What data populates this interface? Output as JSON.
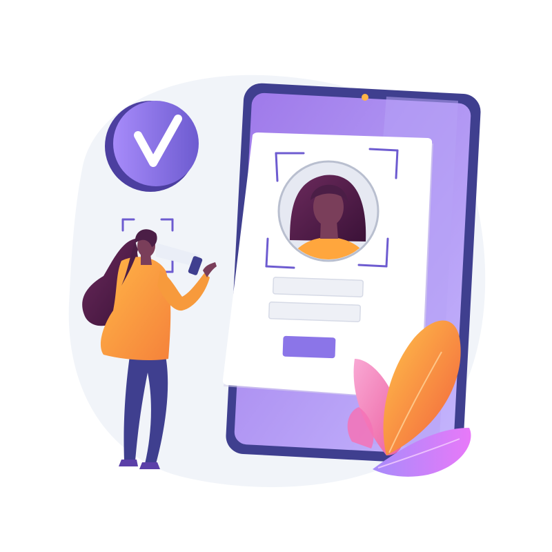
{
  "illustration": {
    "subject": "",
    "colors": {
      "background_blob": "#F1F4F9",
      "purple_light": "#A78BFA",
      "purple": "#8B5CF6",
      "purple_dark": "#5B3FA8",
      "indigo": "#3F3F8F",
      "orange": "#F59E3B",
      "orange_light": "#FFB547",
      "pink": "#F472B6",
      "skin": "#7A3E5A",
      "hair": "#4B1E46",
      "card": "#FFFFFF",
      "field": "#EEF0F6"
    },
    "badge": {
      "icon": "checkmark-icon",
      "state": "verified"
    },
    "phone": {
      "icon": "smartphone-icon"
    },
    "id_card": {
      "avatar_icon": "user-portrait-icon",
      "scan_frame_icon": "face-scan-frame-icon",
      "input_fields": [
        {
          "value": "",
          "placeholder": ""
        },
        {
          "value": "",
          "placeholder": ""
        }
      ],
      "submit_button_label": ""
    },
    "person": {
      "icon": "woman-holding-phone-icon"
    },
    "plant": {
      "icon": "leaves-icon"
    }
  }
}
